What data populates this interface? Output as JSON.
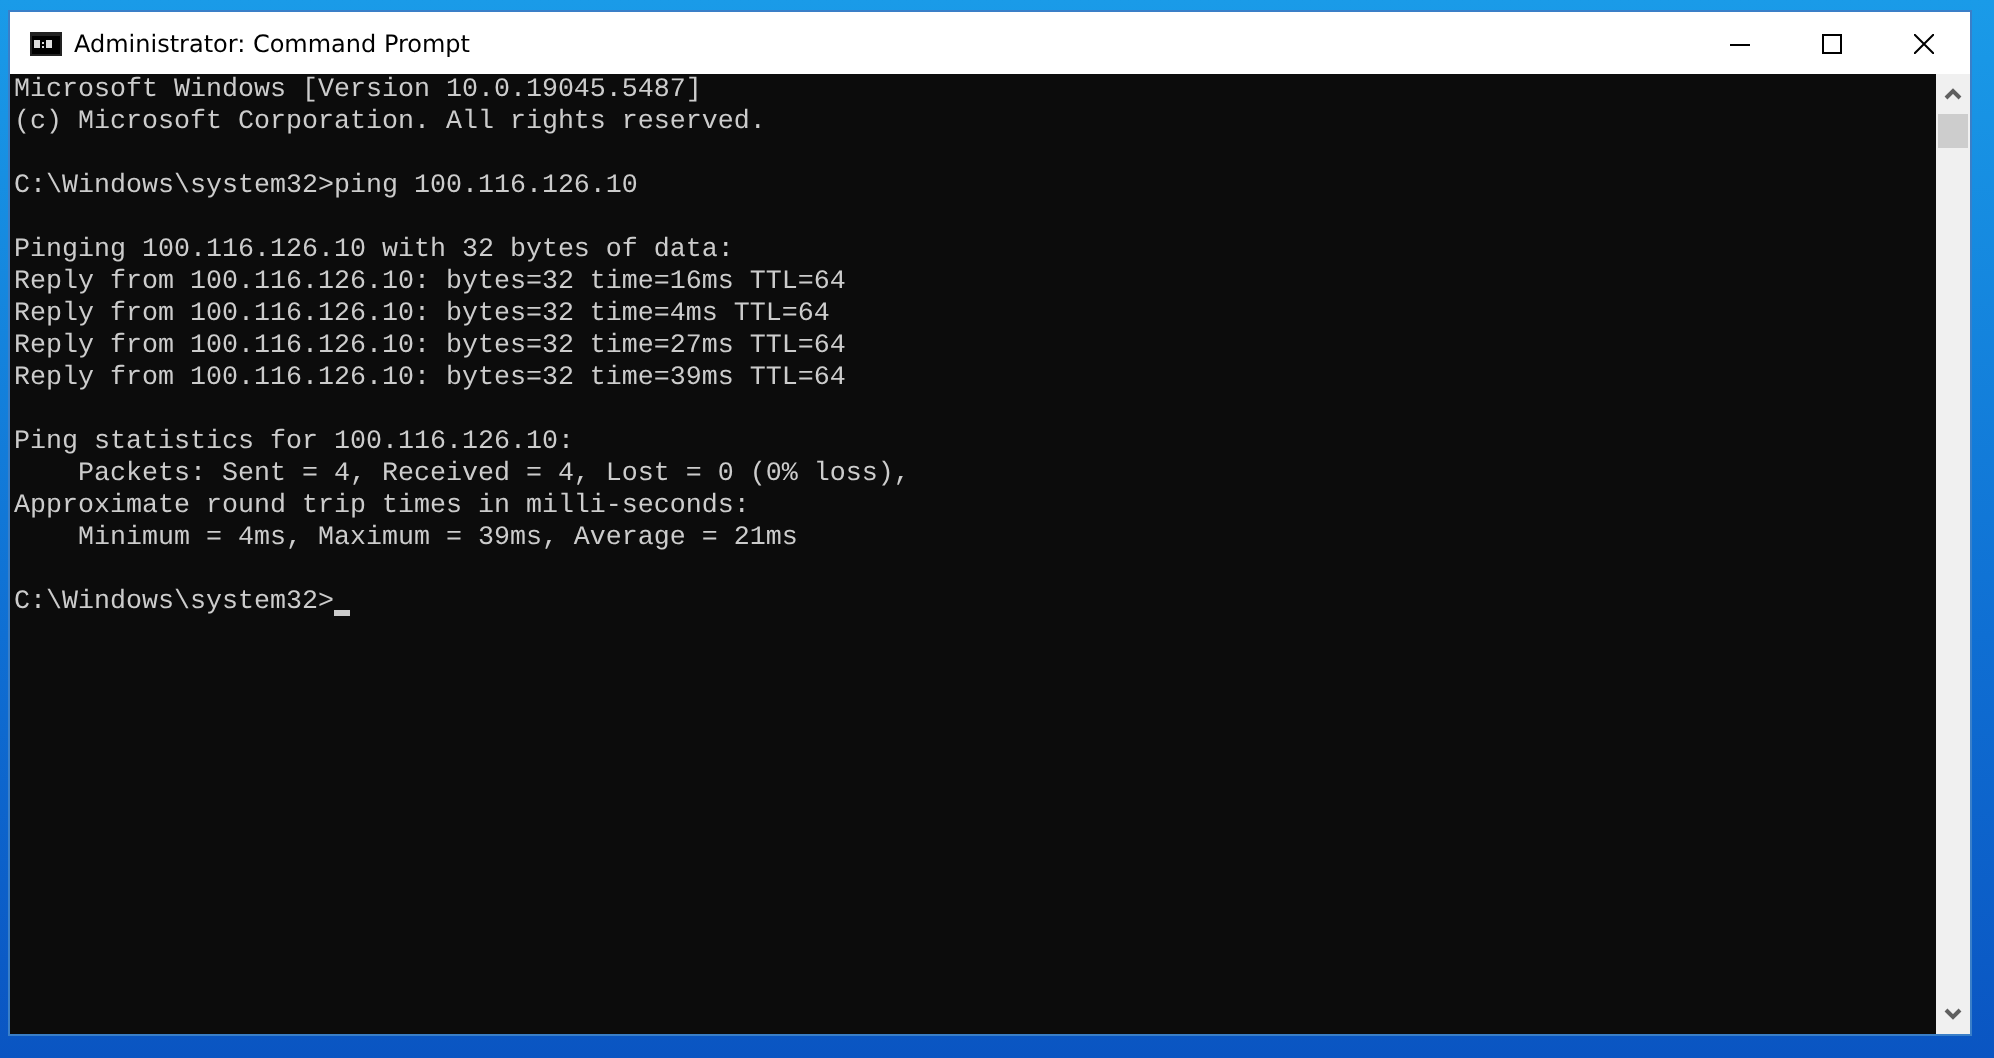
{
  "window": {
    "title": "Administrator: Command Prompt"
  },
  "console": {
    "blocks": [
      [
        "Microsoft Windows [Version 10.0.19045.5487]",
        "(c) Microsoft Corporation. All rights reserved."
      ],
      [
        "C:\\Windows\\system32>ping 100.116.126.10"
      ],
      [
        "Pinging 100.116.126.10 with 32 bytes of data:",
        "Reply from 100.116.126.10: bytes=32 time=16ms TTL=64",
        "Reply from 100.116.126.10: bytes=32 time=4ms TTL=64",
        "Reply from 100.116.126.10: bytes=32 time=27ms TTL=64",
        "Reply from 100.116.126.10: bytes=32 time=39ms TTL=64"
      ],
      [
        "Ping statistics for 100.116.126.10:",
        "    Packets: Sent = 4, Received = 4, Lost = 0 (0% loss),",
        "Approximate round trip times in milli-seconds:",
        "    Minimum = 4ms, Maximum = 39ms, Average = 21ms"
      ]
    ],
    "prompt": "C:\\Windows\\system32>"
  }
}
